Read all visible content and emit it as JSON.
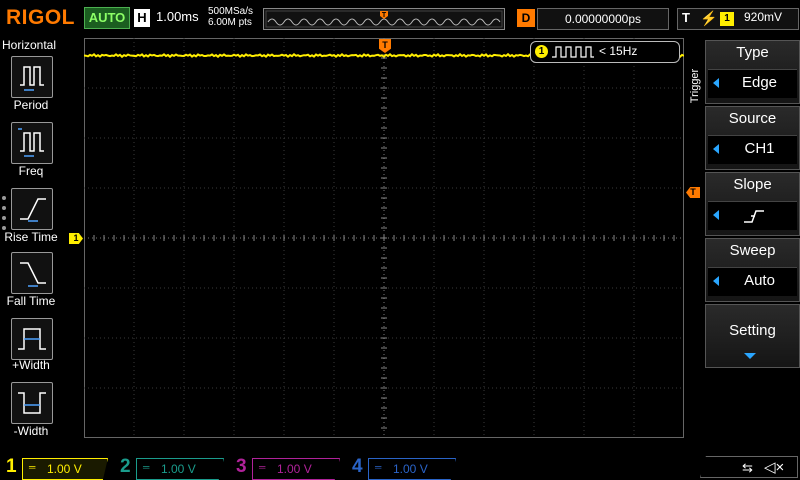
{
  "header": {
    "brand": "RIGOL",
    "run_mode": "AUTO",
    "horizontal_label": "H",
    "timebase": "1.00ms",
    "sample_rate": "500MSa/s",
    "memory_depth": "6.00M pts",
    "delay_label": "D",
    "delay_value": "0.00000000ps",
    "trigger_label": "T",
    "trigger_channel": "1",
    "trigger_level": "920mV"
  },
  "left_menu": {
    "title": "Horizontal",
    "items": [
      {
        "label": "Period",
        "icon": "period-icon"
      },
      {
        "label": "Freq",
        "icon": "freq-icon"
      },
      {
        "label": "Rise Time",
        "icon": "rise-time-icon"
      },
      {
        "label": "Fall Time",
        "icon": "fall-time-icon"
      },
      {
        "label": "+Width",
        "icon": "pos-width-icon"
      },
      {
        "label": "-Width",
        "icon": "neg-width-icon"
      }
    ]
  },
  "waveform": {
    "channel_marker": "1",
    "trigger_pos_marker": "T",
    "trigger_level_marker": "T",
    "freq_readout_channel": "1",
    "freq_readout": "< 15Hz",
    "trace_color": "#ffee00",
    "trace_level_divisions_from_top": 0.35
  },
  "right_menu": {
    "section_label": "Trigger",
    "items": [
      {
        "title": "Type",
        "value": "Edge"
      },
      {
        "title": "Source",
        "value": "CH1"
      },
      {
        "title": "Slope",
        "value": ""
      },
      {
        "title": "Sweep",
        "value": "Auto"
      },
      {
        "title": "Setting",
        "value": ""
      }
    ]
  },
  "channels": [
    {
      "num": "1",
      "coupling": "═",
      "scale": "1.00 V",
      "color": "#ffee00",
      "active": true
    },
    {
      "num": "2",
      "coupling": "═",
      "scale": "1.00 V",
      "color": "#1a9c8c",
      "active": false
    },
    {
      "num": "3",
      "coupling": "═",
      "scale": "1.00 V",
      "color": "#b0229a",
      "active": false
    },
    {
      "num": "4",
      "coupling": "═",
      "scale": "1.00 V",
      "color": "#2a64c8",
      "active": false
    }
  ],
  "colors": {
    "accent_orange": "#ff7a00",
    "ch1_yellow": "#ffee00",
    "menu_arrow_blue": "#2aa6ff"
  }
}
